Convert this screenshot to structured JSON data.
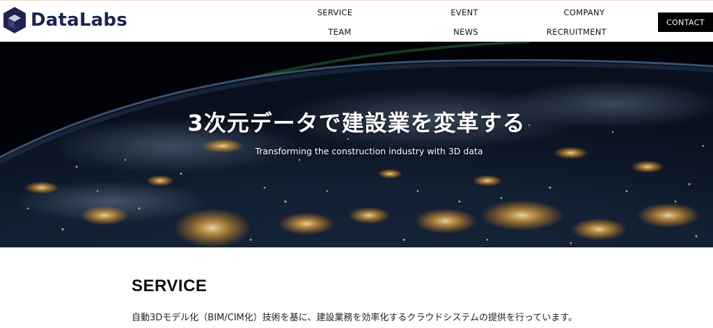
{
  "brand": {
    "name": "DataLabs",
    "color": "#1f2350"
  },
  "nav": {
    "items": [
      {
        "id": "service",
        "label": "SERVICE"
      },
      {
        "id": "event",
        "label": "EVENT"
      },
      {
        "id": "company",
        "label": "COMPANY"
      },
      {
        "id": "team",
        "label": "TEAM"
      },
      {
        "id": "news",
        "label": "NEWS"
      },
      {
        "id": "recruitment",
        "label": "RECRUITMENT"
      }
    ],
    "contact_label": "CONTACT"
  },
  "hero": {
    "title": "3次元データで建設業を変革する",
    "subtitle": "Transforming the construction industry with 3D data",
    "image": "earth-at-night-city-lights"
  },
  "service": {
    "heading": "SERVICE",
    "description": "自動3Dモデル化（BIM/CIM化）技術を基に、建設業務を効率化するクラウドシステムの提供を行っています。"
  },
  "colors": {
    "contact_bg": "#000000",
    "header_bg": "#ffffff",
    "text": "#111111"
  }
}
